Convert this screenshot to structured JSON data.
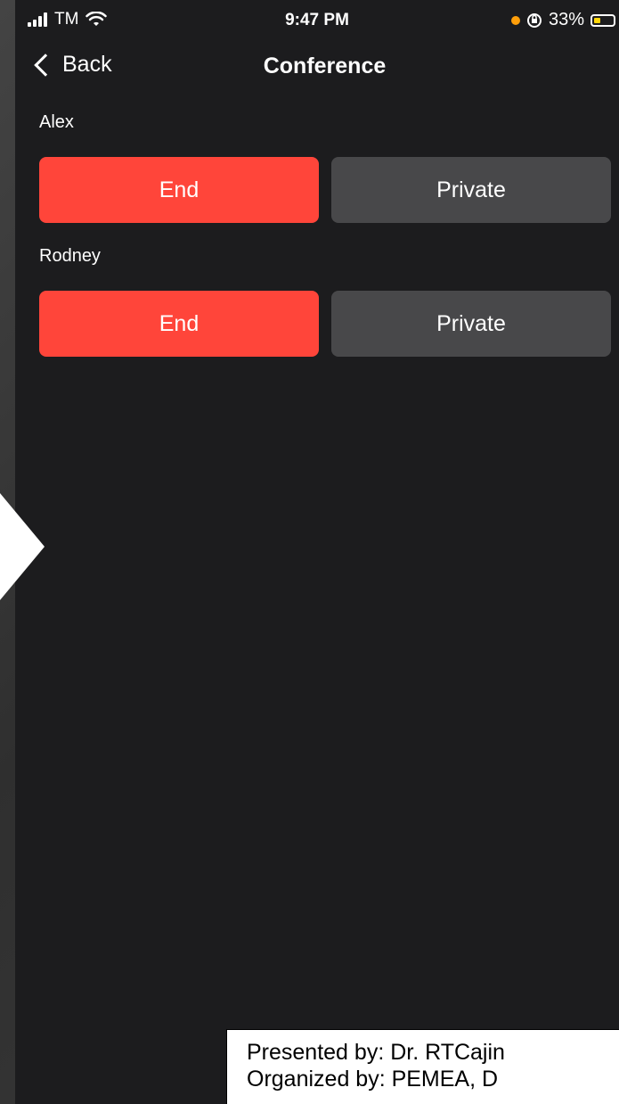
{
  "status_bar": {
    "carrier": "TM",
    "time": "9:47 PM",
    "battery_text": "33%",
    "battery_level": 0.33,
    "indicator_color": "#ff9f0a"
  },
  "nav": {
    "back_label": "Back",
    "title": "Conference"
  },
  "participants": [
    {
      "name": "Alex",
      "end_label": "End",
      "private_label": "Private"
    },
    {
      "name": "Rodney",
      "end_label": "End",
      "private_label": "Private"
    }
  ],
  "colors": {
    "end": "#ff453a",
    "private": "#48484a",
    "background": "#1c1c1e"
  },
  "caption": {
    "line1": "Presented by: Dr. RTCajin",
    "line2": "Organized by: PEMEA, D"
  }
}
